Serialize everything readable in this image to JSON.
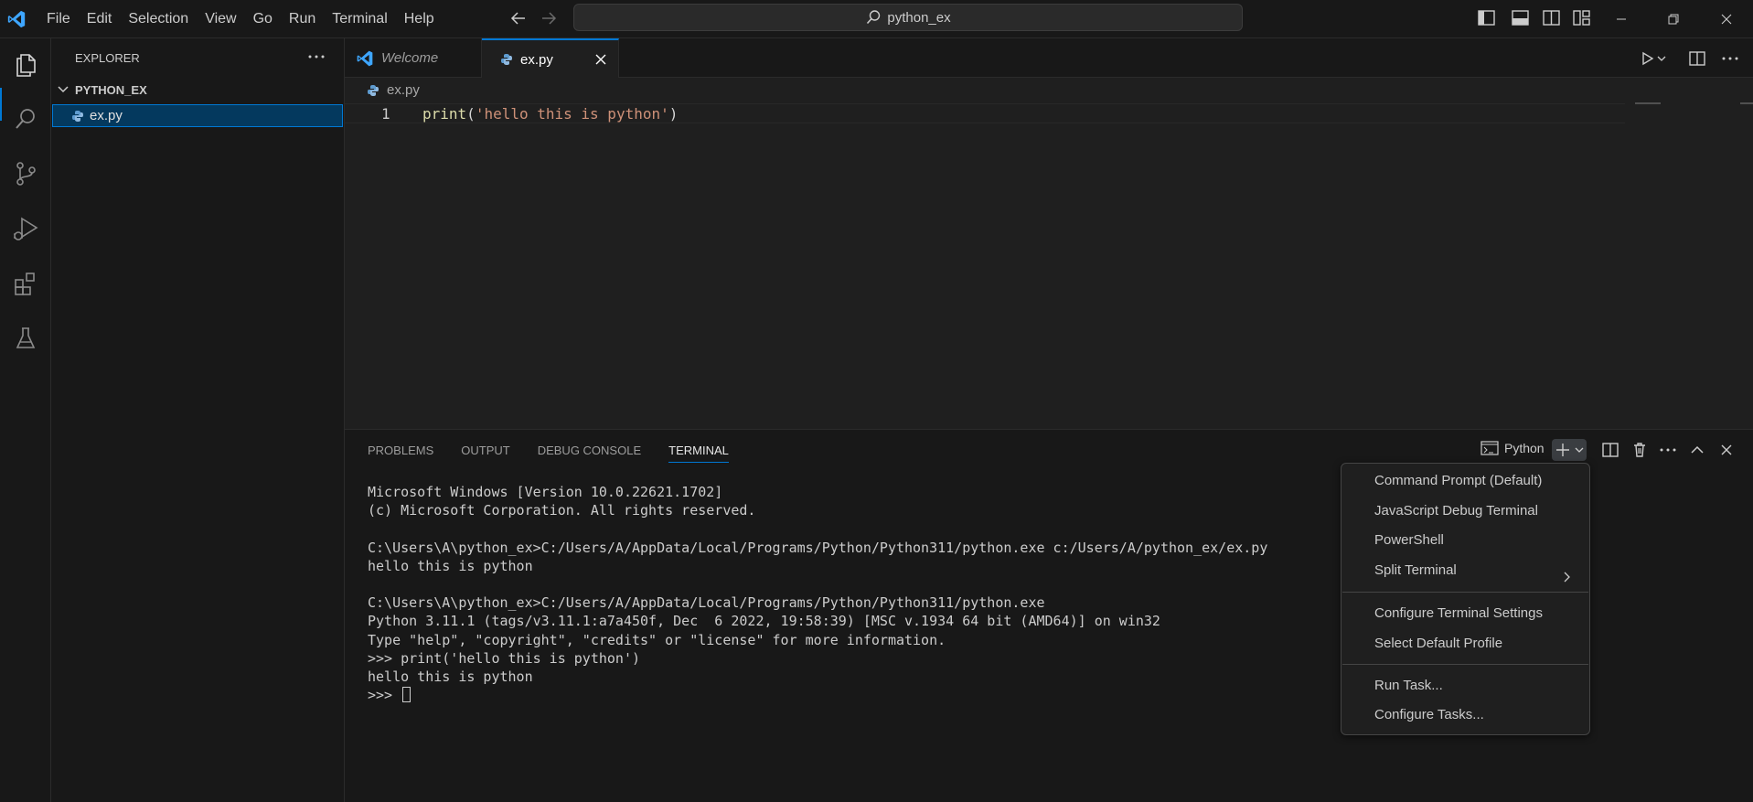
{
  "titlebar": {
    "menu": [
      "File",
      "Edit",
      "Selection",
      "View",
      "Go",
      "Run",
      "Terminal",
      "Help"
    ],
    "search_text": "python_ex"
  },
  "sidebar": {
    "title": "EXPLORER",
    "folder": "PYTHON_EX",
    "file": "ex.py"
  },
  "tabs": [
    {
      "label": "Welcome"
    },
    {
      "label": "ex.py"
    }
  ],
  "editor": {
    "breadcrumb": "ex.py",
    "line_number": "1",
    "code": {
      "fn": "print",
      "open": "(",
      "str": "'hello this is python'",
      "close": ")"
    }
  },
  "panel": {
    "tabs": [
      "PROBLEMS",
      "OUTPUT",
      "DEBUG CONSOLE",
      "TERMINAL"
    ],
    "terminal_profile": "Python",
    "terminal_lines": [
      "Microsoft Windows [Version 10.0.22621.1702]",
      "(c) Microsoft Corporation. All rights reserved.",
      "",
      "C:\\Users\\A\\python_ex>C:/Users/A/AppData/Local/Programs/Python/Python311/python.exe c:/Users/A/python_ex/ex.py",
      "hello this is python",
      "",
      "C:\\Users\\A\\python_ex>C:/Users/A/AppData/Local/Programs/Python/Python311/python.exe",
      "Python 3.11.1 (tags/v3.11.1:a7a450f, Dec  6 2022, 19:58:39) [MSC v.1934 64 bit (AMD64)] on win32",
      "Type \"help\", \"copyright\", \"credits\" or \"license\" for more information.",
      ">>> print('hello this is python')",
      "hello this is python"
    ],
    "prompt": ">>> "
  },
  "dropdown": {
    "items": [
      "Command Prompt (Default)",
      "JavaScript Debug Terminal",
      "PowerShell",
      "Split Terminal",
      "Configure Terminal Settings",
      "Select Default Profile",
      "Run Task...",
      "Configure Tasks..."
    ]
  },
  "colors": {
    "accent": "#0078d4",
    "background": "#1f1f1f",
    "sidebar": "#181818",
    "string": "#ce9178",
    "function": "#dcdcaa"
  }
}
